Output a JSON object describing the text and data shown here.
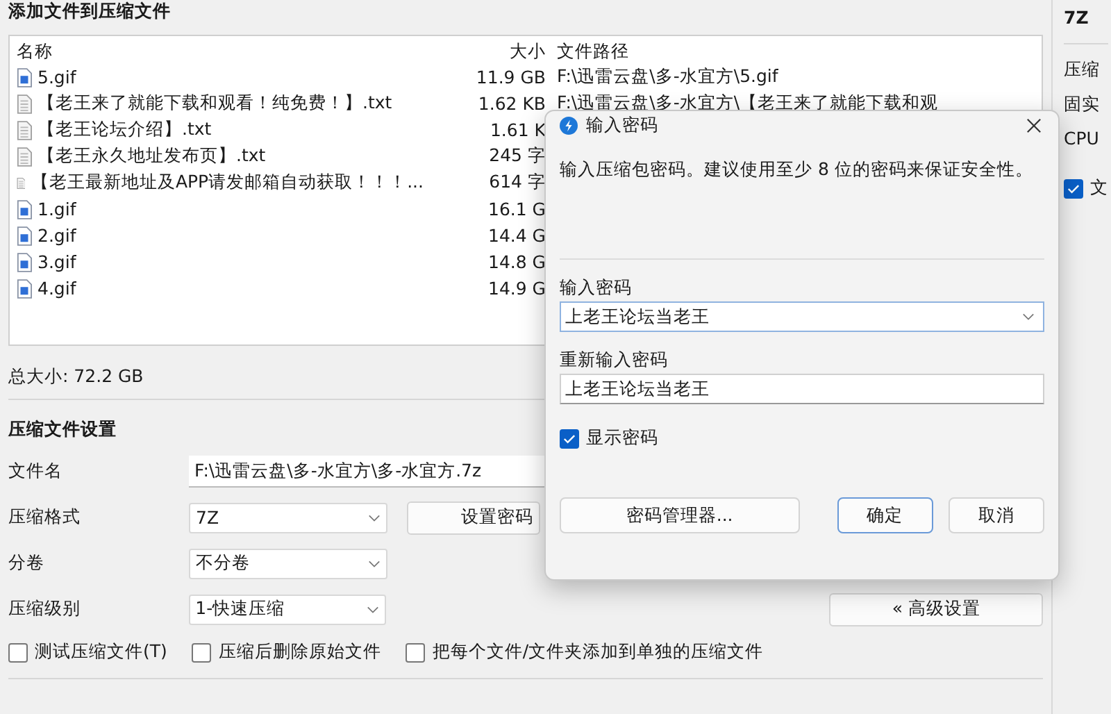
{
  "main": {
    "title": "添加文件到压缩文件",
    "file_list": {
      "columns": [
        "名称",
        "大小",
        "文件路径"
      ],
      "rows": [
        {
          "kind": "gif",
          "name": "5.gif",
          "size": "11.9 GB",
          "path": "F:\\迅雷云盘\\多-水宜方\\5.gif"
        },
        {
          "kind": "txt",
          "name": "【老王来了就能下载和观看！纯免费！】.txt",
          "size": "1.62 KB",
          "path": "F:\\迅雷云盘\\多-水宜方\\【老王来了就能下载和观"
        },
        {
          "kind": "txt",
          "name": "【老王论坛介绍】.txt",
          "size": "1.61 K"
        },
        {
          "kind": "txt",
          "name": "【老王永久地址发布页】.txt",
          "size": "245 字"
        },
        {
          "kind": "txt",
          "name": "【老王最新地址及APP请发邮箱自动获取！！！...",
          "size": "614 字"
        },
        {
          "kind": "gif",
          "name": "1.gif",
          "size": "16.1 G"
        },
        {
          "kind": "gif",
          "name": "2.gif",
          "size": "14.4 G"
        },
        {
          "kind": "gif",
          "name": "3.gif",
          "size": "14.8 G"
        },
        {
          "kind": "gif",
          "name": "4.gif",
          "size": "14.9 G"
        }
      ]
    },
    "total": "总大小: 72.2 GB",
    "settings": {
      "title": "压缩文件设置",
      "fields": [
        {
          "kind": "text",
          "label": "文件名",
          "value": "F:\\迅雷云盘\\多-水宜方\\多-水宜方.7z"
        },
        {
          "kind": "select",
          "label": "压缩格式",
          "value": "7Z",
          "button": "设置密码"
        },
        {
          "kind": "select",
          "label": "分卷",
          "value": "不分卷"
        },
        {
          "kind": "select",
          "label": "压缩级别",
          "value": "1-快速压缩",
          "button": "« 高级设置"
        }
      ],
      "options": [
        {
          "label": "测试压缩文件(T)",
          "checked": false
        },
        {
          "label": "压缩后删除原始文件",
          "checked": false
        },
        {
          "label": "把每个文件/文件夹添加到单独的压缩文件",
          "checked": false
        }
      ]
    }
  },
  "side_panel": {
    "title": "7Z",
    "labels": [
      "压缩",
      "固实",
      "CPU"
    ],
    "checkbox": {
      "label": "文",
      "checked": true
    }
  },
  "dialog": {
    "title": "输入密码",
    "message": "输入压缩包密码。建议使用至少 8 位的密码来保证安全性。",
    "password_label": "输入密码",
    "password": "上老王论坛当老王",
    "repeat_label": "重新输入密码",
    "repeat": "上老王论坛当老王",
    "show_password": {
      "label": "显示密码",
      "checked": true
    },
    "buttons": [
      {
        "label": "密码管理器...",
        "kind": "secondary"
      },
      {
        "label": "确定",
        "kind": "default"
      },
      {
        "label": "取消",
        "kind": "secondary"
      }
    ]
  }
}
